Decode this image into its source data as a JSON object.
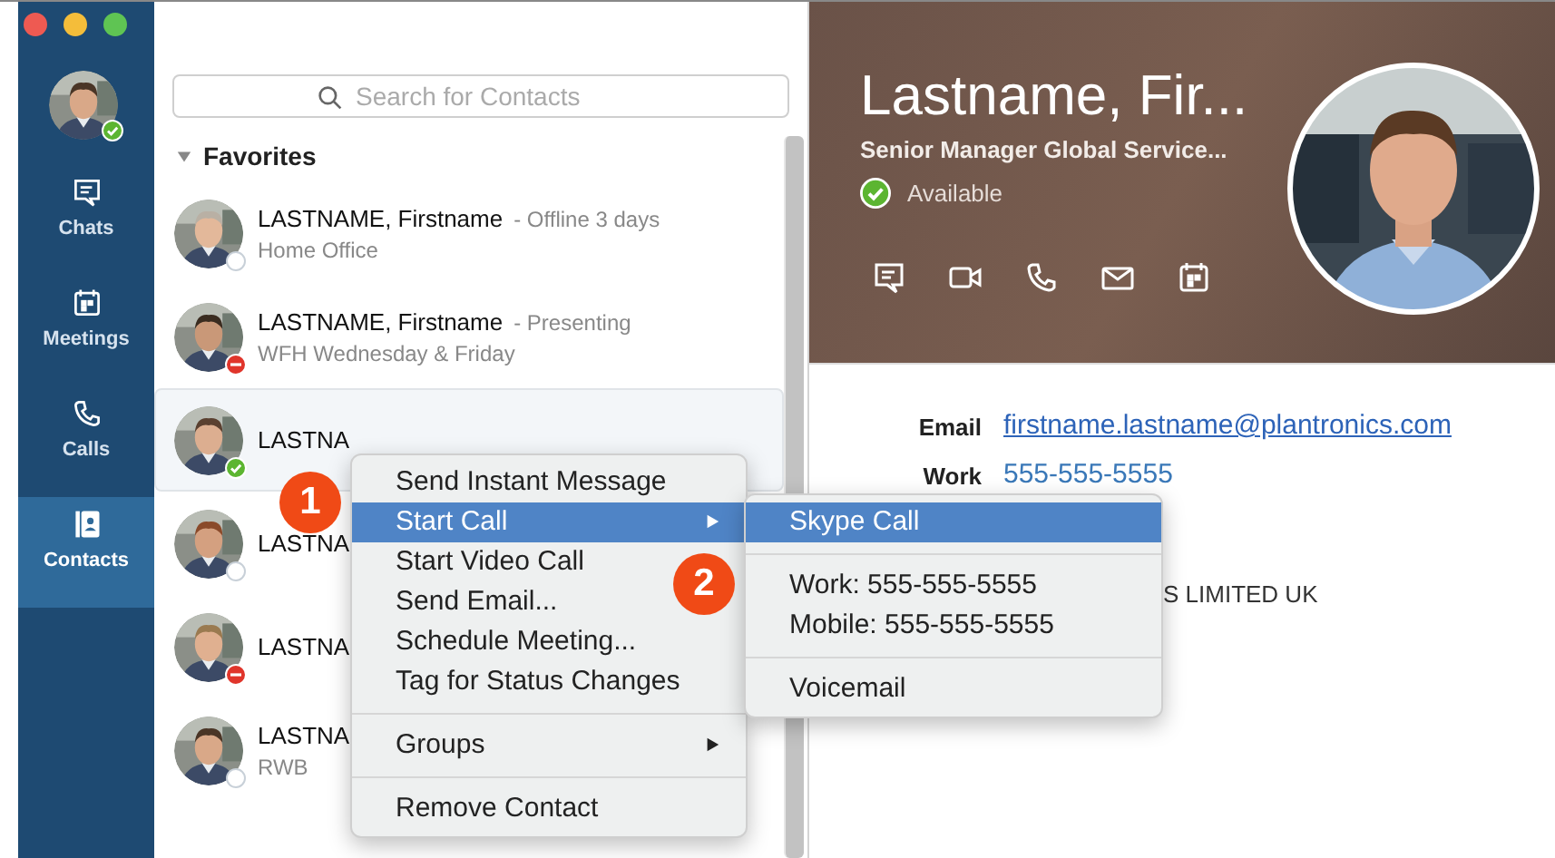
{
  "nav": {
    "user_status": {
      "kind": "available"
    },
    "items": [
      {
        "label": "Chats",
        "kind": "chat",
        "selected": false
      },
      {
        "label": "Meetings",
        "kind": "calendar",
        "selected": false
      },
      {
        "label": "Calls",
        "kind": "phone",
        "selected": false
      },
      {
        "label": "Contacts",
        "kind": "contacts",
        "selected": true
      }
    ]
  },
  "search": {
    "placeholder": "Search for Contacts"
  },
  "group": {
    "label": "Favorites",
    "expanded": true
  },
  "contacts": [
    {
      "name": "LASTNAME, Firstname",
      "presence": "- Offline 3 days",
      "note": "Home Office",
      "status": {
        "kind": "offline"
      },
      "selected": false
    },
    {
      "name": "LASTNAME, Firstname",
      "presence": "- Presenting",
      "note": "WFH Wednesday & Friday",
      "status": {
        "kind": "busy"
      },
      "selected": false
    },
    {
      "name": "LASTNA",
      "status": {
        "kind": "available"
      },
      "selected": true
    },
    {
      "name": "LASTNA",
      "status": {
        "kind": "offline"
      },
      "selected": false
    },
    {
      "name": "LASTNA",
      "status": {
        "kind": "busy"
      },
      "selected": false
    },
    {
      "name": "LASTNA",
      "note": "RWB",
      "status": {
        "kind": "offline"
      },
      "selected": false
    }
  ],
  "profile": {
    "name": "Lastname, Fir...",
    "title": "Senior Manager Global Service...",
    "status": {
      "kind": "available"
    },
    "status_label": "Available",
    "actions": [
      {
        "kind": "chat"
      },
      {
        "kind": "video"
      },
      {
        "kind": "phone"
      },
      {
        "kind": "mail"
      },
      {
        "kind": "calendar"
      }
    ],
    "details": [
      {
        "label": "Email",
        "value": "firstname.lastname@plantronics.com",
        "kind": "link"
      },
      {
        "label": "Work",
        "value": "555-555-5555",
        "kind": "phone"
      },
      {
        "value": "S LIMITED UK",
        "kind": "text"
      }
    ]
  },
  "context_menu": [
    {
      "kind": "item",
      "label": "Send Instant Message",
      "selected": false
    },
    {
      "kind": "item",
      "label": "Start Call",
      "selected": true,
      "submenu": true
    },
    {
      "kind": "item",
      "label": "Start Video Call",
      "selected": false
    },
    {
      "kind": "item",
      "label": "Send Email...",
      "selected": false
    },
    {
      "kind": "item",
      "label": "Schedule Meeting...",
      "selected": false
    },
    {
      "kind": "item",
      "label": "Tag for Status Changes",
      "selected": false
    },
    {
      "kind": "separator"
    },
    {
      "kind": "item",
      "label": "Groups",
      "selected": false,
      "submenu": true
    },
    {
      "kind": "separator"
    },
    {
      "kind": "item",
      "label": "Remove Contact",
      "selected": false
    }
  ],
  "submenu": [
    {
      "kind": "item",
      "label": "Skype Call",
      "selected": true
    },
    {
      "kind": "separator"
    },
    {
      "kind": "item",
      "label": "Work: 555-555-5555",
      "selected": false
    },
    {
      "kind": "item",
      "label": "Mobile: 555-555-5555",
      "selected": false
    },
    {
      "kind": "separator"
    },
    {
      "kind": "item",
      "label": "Voicemail",
      "selected": false
    }
  ],
  "callouts": [
    "1",
    "2"
  ]
}
